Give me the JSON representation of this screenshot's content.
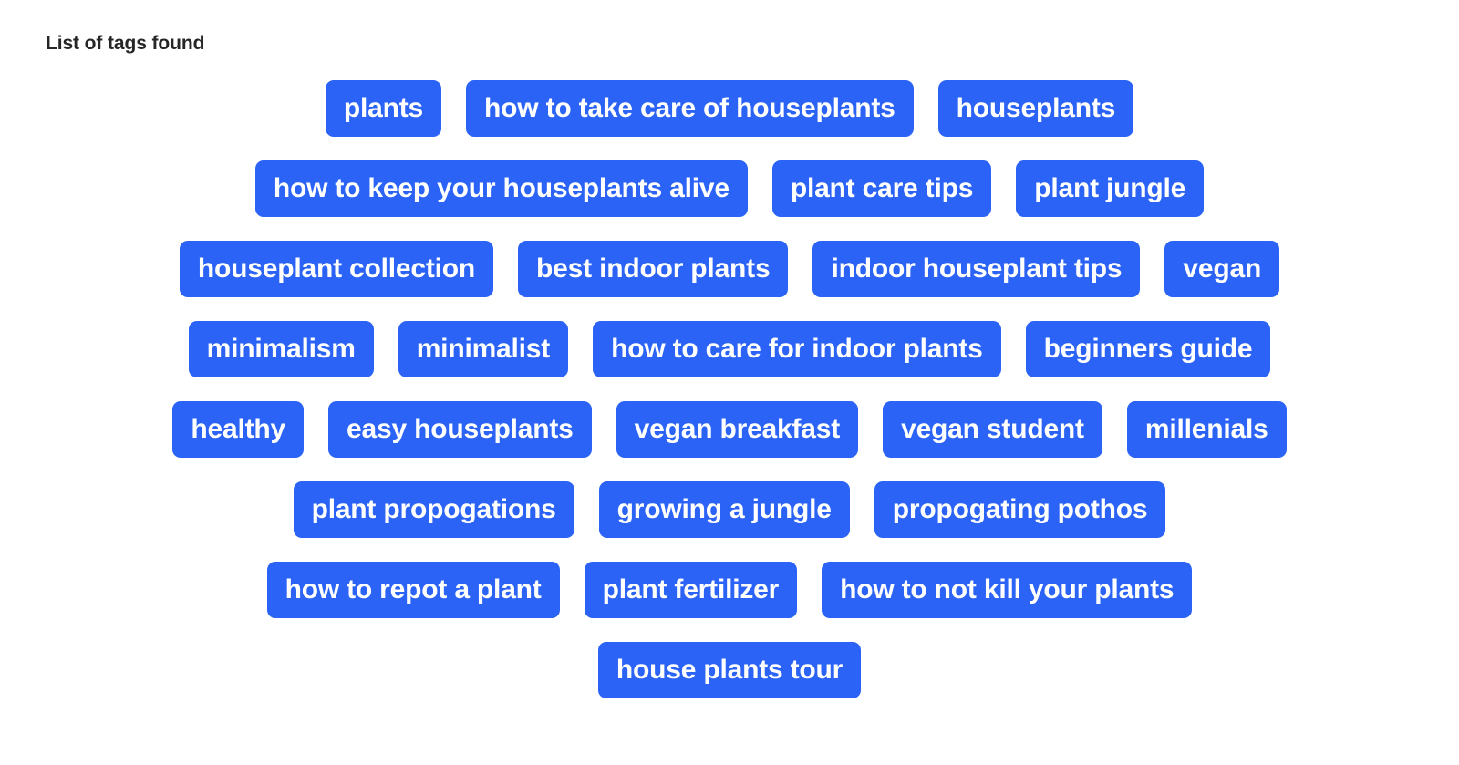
{
  "page": {
    "title": "List of tags found",
    "background_color": "#ffffff",
    "title_color": "#262626",
    "tag_background_color": "#2A63F6",
    "tag_text_color": "#ffffff"
  },
  "tag_rows": [
    {
      "tags": [
        {
          "label": "plants"
        },
        {
          "label": "how to take care of houseplants"
        },
        {
          "label": "houseplants"
        }
      ]
    },
    {
      "tags": [
        {
          "label": "how to keep your houseplants alive"
        },
        {
          "label": "plant care tips"
        },
        {
          "label": "plant jungle"
        }
      ]
    },
    {
      "tags": [
        {
          "label": "houseplant collection"
        },
        {
          "label": "best indoor plants"
        },
        {
          "label": "indoor houseplant tips"
        },
        {
          "label": "vegan"
        }
      ]
    },
    {
      "tags": [
        {
          "label": "minimalism"
        },
        {
          "label": "minimalist"
        },
        {
          "label": "how to care for indoor plants"
        },
        {
          "label": "beginners guide"
        }
      ]
    },
    {
      "tags": [
        {
          "label": "healthy"
        },
        {
          "label": "easy houseplants"
        },
        {
          "label": "vegan breakfast"
        },
        {
          "label": "vegan student"
        },
        {
          "label": "millenials"
        }
      ]
    },
    {
      "tags": [
        {
          "label": "plant propogations"
        },
        {
          "label": "growing a jungle"
        },
        {
          "label": "propogating pothos"
        }
      ]
    },
    {
      "tags": [
        {
          "label": "how to repot a plant"
        },
        {
          "label": "plant fertilizer"
        },
        {
          "label": "how to not kill your plants"
        }
      ]
    },
    {
      "tags": [
        {
          "label": "house plants tour"
        }
      ]
    }
  ]
}
